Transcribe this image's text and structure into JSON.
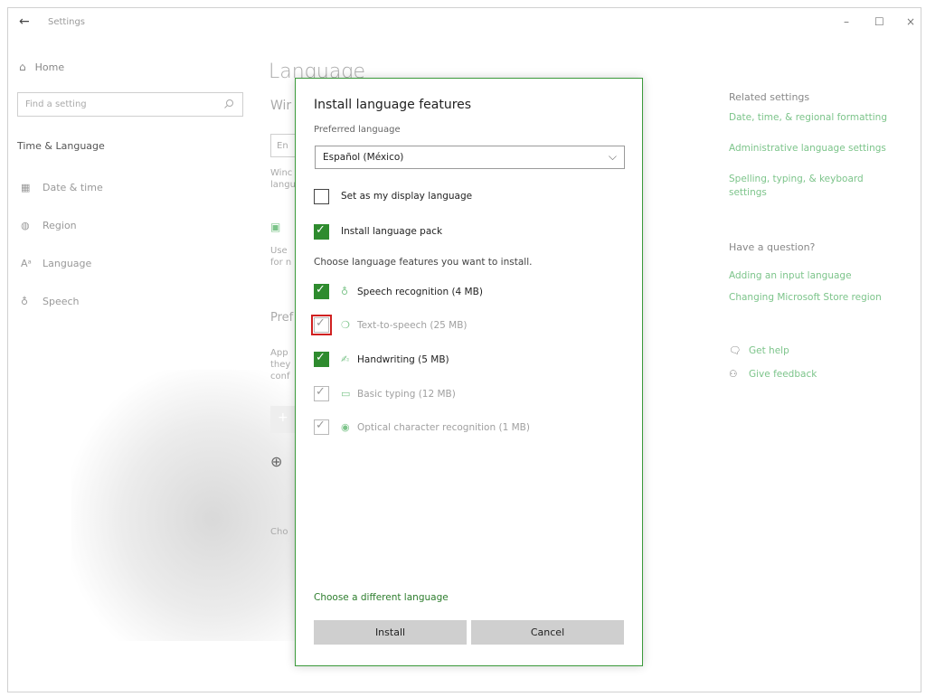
{
  "window": {
    "title": "Settings",
    "back_icon": "back-arrow-icon",
    "minimize": "–",
    "maximize": "☐",
    "close": "×"
  },
  "nav": {
    "home": "Home",
    "search_placeholder": "Find a setting",
    "section": "Time & Language",
    "items": [
      {
        "label": "Date & time",
        "icon": "calendar-icon"
      },
      {
        "label": "Region",
        "icon": "globe-icon"
      },
      {
        "label": "Language",
        "icon": "language-icon"
      },
      {
        "label": "Speech",
        "icon": "microphone-icon"
      }
    ]
  },
  "main": {
    "heading": "Language",
    "fragments": {
      "f1": "Wir",
      "f2": "En",
      "f3": "Winc",
      "f4": "langu",
      "f5": "Use",
      "f6": "for n",
      "f7": "Pref",
      "f8": "App",
      "f9": "they",
      "f10": "conf",
      "f11": "Cho"
    }
  },
  "right": {
    "related_title": "Related settings",
    "related_links": [
      "Date, time, & regional formatting",
      "Administrative language settings",
      "Spelling, typing, & keyboard settings"
    ],
    "question_title": "Have a question?",
    "question_links": [
      "Adding an input language",
      "Changing Microsoft Store region"
    ],
    "help": "Get help",
    "feedback": "Give feedback"
  },
  "dialog": {
    "title": "Install language features",
    "preferred_label": "Preferred language",
    "preferred_value": "Español (México)",
    "set_display": {
      "label": "Set as my display language",
      "checked": false
    },
    "install_pack": {
      "label": "Install language pack",
      "checked": true
    },
    "choose_label": "Choose language features you want to install.",
    "features": [
      {
        "label": "Speech recognition (4 MB)",
        "icon": "microphone-icon",
        "checked": true,
        "disabled": false
      },
      {
        "label": "Text-to-speech (25 MB)",
        "icon": "speech-bubble-icon",
        "checked": true,
        "disabled": true,
        "highlighted": true
      },
      {
        "label": "Handwriting (5 MB)",
        "icon": "pen-icon",
        "checked": true,
        "disabled": false
      },
      {
        "label": "Basic typing (12 MB)",
        "icon": "keyboard-icon",
        "checked": true,
        "disabled": true
      },
      {
        "label": "Optical character recognition (1 MB)",
        "icon": "ocr-icon",
        "checked": true,
        "disabled": true
      }
    ],
    "different_language": "Choose a different language",
    "install": "Install",
    "cancel": "Cancel"
  },
  "colors": {
    "accent": "#2e8b2e",
    "link": "#7cc48a",
    "highlight": "#d02020"
  }
}
